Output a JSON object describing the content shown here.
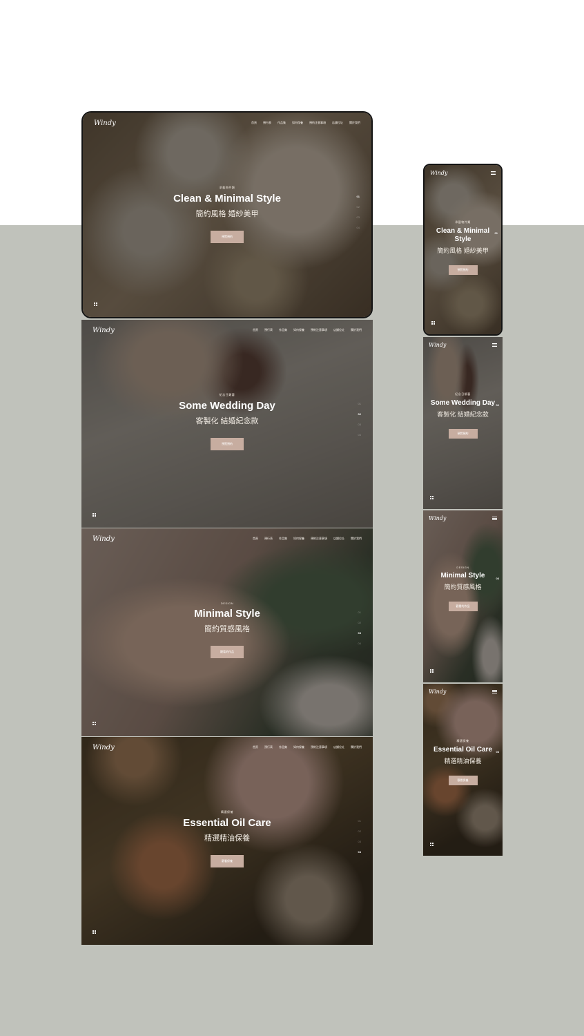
{
  "brand": {
    "logo": "Windy"
  },
  "nav": {
    "items": [
      "首頁",
      "預行表",
      "作品集",
      "如何保養",
      "預約注意事項",
      "店鋪位址",
      "關於我們"
    ]
  },
  "slides": [
    {
      "eyebrow": "承載物件類",
      "title": "Clean & Minimal Style",
      "subtitle": "簡約風格 婚紗美甲",
      "button": "預覽預約",
      "index": "01"
    },
    {
      "eyebrow": "紀念日類藝",
      "title": "Some Wedding Day",
      "subtitle": "客製化 結婚紀念款",
      "button": "預覽預約",
      "index": "02"
    },
    {
      "eyebrow": "DESIGN",
      "title": "Minimal Style",
      "subtitle": "簡約質感風格",
      "button": "觀看的作品",
      "index": "03"
    },
    {
      "eyebrow": "精選保養",
      "title": "Essential Oil Care",
      "subtitle": "精選精油保養",
      "button": "觀看保養",
      "index": "04"
    }
  ],
  "pager": [
    "01",
    "02",
    "03",
    "04"
  ],
  "colors": {
    "backdrop": "#c0c2bb",
    "button": "#c7ada0",
    "overlay": "#1c1814"
  },
  "icons": {
    "grid": "grid-icon",
    "menu": "hamburger-menu-icon"
  }
}
